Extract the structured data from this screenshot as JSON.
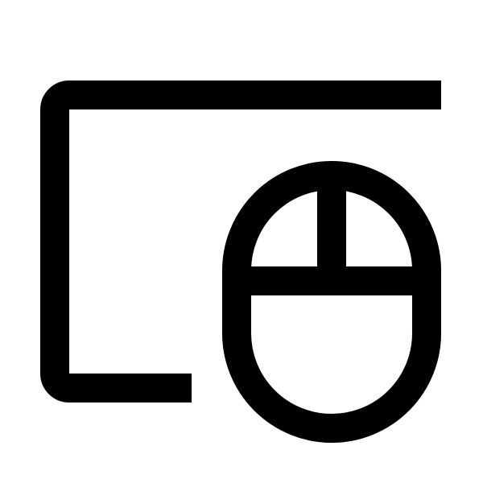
{
  "icon": {
    "name": "screen-with-mouse-icon",
    "parts": [
      "screen-frame-icon",
      "mouse-icon"
    ],
    "stroke_color": "#000000",
    "background_color": "#ffffff"
  }
}
